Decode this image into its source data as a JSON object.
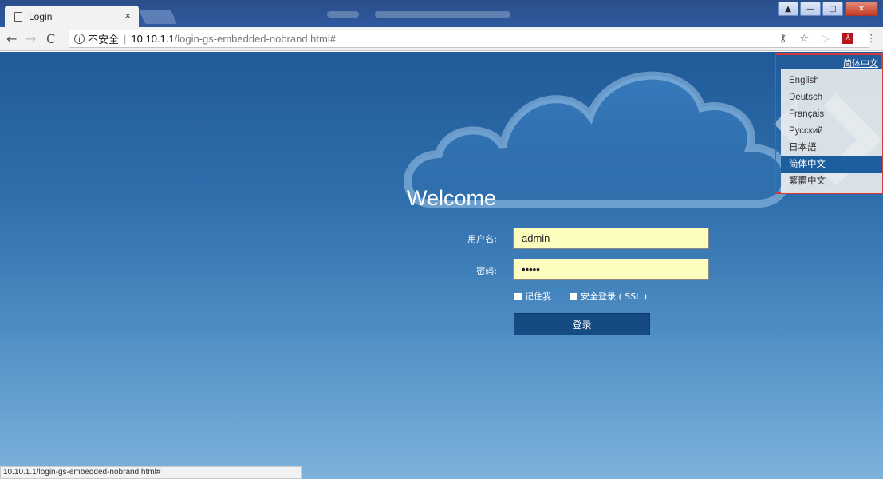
{
  "browser": {
    "tab_title": "Login",
    "tab_close": "×",
    "security_label": "不安全",
    "url_host": "10.10.1.1",
    "url_path": "/login-gs-embedded-nobrand.html#",
    "status_url": "10.10.1.1/login-gs-embedded-nobrand.html#"
  },
  "login": {
    "welcome": "Welcome",
    "username_label": "用户名:",
    "username_value": "admin",
    "password_label": "密码:",
    "password_value": "•••••",
    "remember_label": "记住我",
    "ssl_label": "安全登录 ( SSL )",
    "submit_label": "登录"
  },
  "language": {
    "current": "简体中文",
    "options": [
      "English",
      "Deutsch",
      "Français",
      "Русский",
      "日本語",
      "简体中文",
      "繁體中文"
    ]
  },
  "colors": {
    "accent": "#164a82",
    "selected": "#1b5f9e",
    "highlight_border": "#d33a3a",
    "field_bg": "#fdfdc0"
  }
}
